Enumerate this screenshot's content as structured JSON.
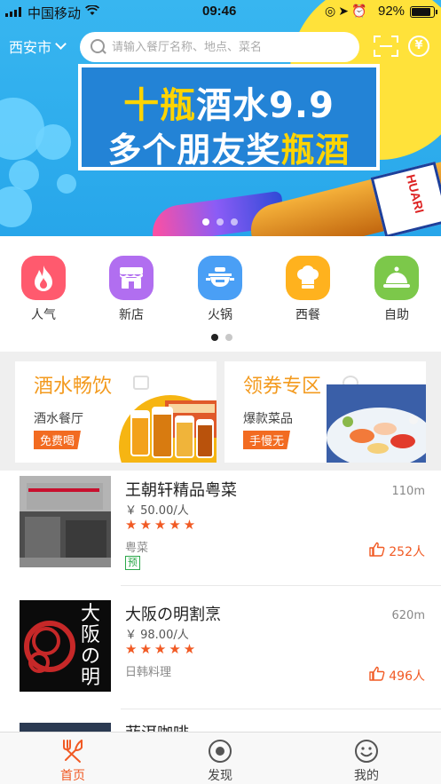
{
  "status_bar": {
    "carrier": "中国移动",
    "time": "09:46",
    "battery": "92%",
    "battery_level": 0.92
  },
  "header": {
    "city": "西安市",
    "search_placeholder": "请输入餐厅名称、地点、菜名"
  },
  "banner": {
    "line1_prefix": "十瓶",
    "line1_suffix": "酒水9.9",
    "line2_prefix": "多个朋友奖",
    "line2_suffix": "瓶酒",
    "bottle_label": "HUARI",
    "slide_count": 3,
    "active_slide": 1
  },
  "categories": {
    "items": [
      {
        "label": "人气",
        "icon": "fire-icon",
        "color": "#ff5a6e"
      },
      {
        "label": "新店",
        "icon": "shop-icon",
        "color": "#b16ef0"
      },
      {
        "label": "火锅",
        "icon": "hotpot-icon",
        "color": "#4a9ff5"
      },
      {
        "label": "西餐",
        "icon": "chef-hat-icon",
        "color": "#ffb21e"
      },
      {
        "label": "自助",
        "icon": "cloche-icon",
        "color": "#7cc84a"
      }
    ],
    "page_count": 2,
    "active_page": 1
  },
  "promos": [
    {
      "title": "酒水畅饮",
      "subtitle": "酒水餐厅",
      "badge": "免费喝"
    },
    {
      "title": "领券专区",
      "subtitle": "爆款菜品",
      "badge": "手慢无"
    }
  ],
  "restaurants": [
    {
      "name": "王朝轩精品粤菜",
      "distance": "110m",
      "price": "￥ 50.00/人",
      "stars": "★★★★★",
      "cuisine": "粤菜",
      "tag": "预",
      "likes": "252人"
    },
    {
      "name": "大阪の明割烹",
      "distance": "620m",
      "price": "￥ 98.00/人",
      "stars": "★★★★★",
      "cuisine": "日韩料理",
      "likes": "496人",
      "logo_text": "大阪の明"
    },
    {
      "name": "菲洱咖啡"
    }
  ],
  "tabbar": {
    "items": [
      {
        "label": "首页",
        "icon": "food-fork-knife-icon",
        "active": true
      },
      {
        "label": "发现",
        "icon": "discover-icon",
        "active": false
      },
      {
        "label": "我的",
        "icon": "smile-face-icon",
        "active": false
      }
    ]
  },
  "colors": {
    "accent": "#f15a24",
    "promo_title": "#f39a1e",
    "banner_blue": "#2383d6",
    "banner_yellow": "#ffd400"
  }
}
